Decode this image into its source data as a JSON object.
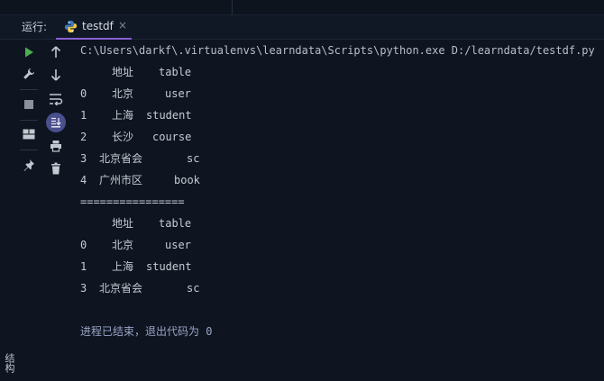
{
  "tool_window": {
    "run_label": "运行:",
    "tab": {
      "label": "testdf",
      "close": "×",
      "icon": "python-icon"
    }
  },
  "toolbar": {
    "left": [
      {
        "name": "run-icon",
        "color": "#4caf50"
      },
      {
        "name": "wrench-icon"
      },
      {
        "name": "stop-icon"
      },
      {
        "name": "layout-icon"
      },
      {
        "name": "pin-icon"
      }
    ],
    "right": [
      {
        "name": "arrow-up-icon"
      },
      {
        "name": "arrow-down-icon"
      },
      {
        "name": "soft-wrap-icon"
      },
      {
        "name": "scroll-to-end-icon",
        "active": true
      },
      {
        "name": "print-icon"
      },
      {
        "name": "trash-icon"
      }
    ]
  },
  "side_panel": {
    "structure_label": "结构"
  },
  "console": {
    "command": "C:\\Users\\darkf\\.virtualenvs\\learndata\\Scripts\\python.exe D:/learndata/testdf.py",
    "table1": {
      "headers": [
        "地址",
        "table"
      ],
      "rows": [
        {
          "index": "0",
          "addr": "北京",
          "table": "user"
        },
        {
          "index": "1",
          "addr": "上海",
          "table": "student"
        },
        {
          "index": "2",
          "addr": "长沙",
          "table": "course"
        },
        {
          "index": "3",
          "addr": "北京省会",
          "table": "sc"
        },
        {
          "index": "4",
          "addr": "广州市区",
          "table": "book"
        }
      ]
    },
    "separator": "================",
    "table2": {
      "headers": [
        "地址",
        "table"
      ],
      "rows": [
        {
          "index": "0",
          "addr": "北京",
          "table": "user"
        },
        {
          "index": "1",
          "addr": "上海",
          "table": "student"
        },
        {
          "index": "3",
          "addr": "北京省会",
          "table": "sc"
        }
      ]
    },
    "exit_message": "进程已结束，退出代码为 0"
  },
  "colors": {
    "background": "#0e1520",
    "accent": "#8a5fd4",
    "run_green": "#4caf50",
    "text": "#c6cbd4"
  }
}
